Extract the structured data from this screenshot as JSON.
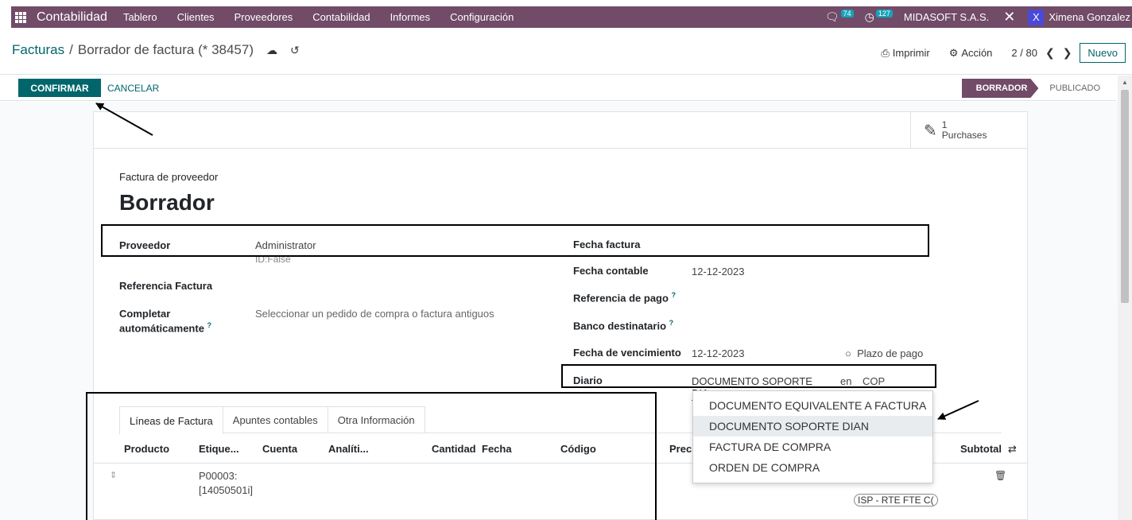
{
  "navbar": {
    "app_name": "Contabilidad",
    "menu": [
      "Tablero",
      "Clientes",
      "Proveedores",
      "Contabilidad",
      "Informes",
      "Configuración"
    ],
    "messages_count": "74",
    "activities_count": "127",
    "company": "MIDASOFT S.A.S.",
    "user_initial": "X",
    "user_name": "Ximena Gonzalez"
  },
  "control_panel": {
    "breadcrumb_parent": "Facturas",
    "breadcrumb_sep": "/",
    "breadcrumb_current": "Borrador de factura (* 38457)",
    "print_label": "Imprimir",
    "action_label": "Acción",
    "pager": "2 / 80",
    "new_label": "Nuevo"
  },
  "statusbar": {
    "confirm_label": "CONFIRMAR",
    "cancel_label": "CANCELAR",
    "stage_active": "BORRADOR",
    "stage_next": "PUBLICADO"
  },
  "smart_button": {
    "count": "1",
    "label": "Purchases"
  },
  "form": {
    "title_label": "Factura de proveedor",
    "title": "Borrador",
    "proveedor_label": "Proveedor",
    "proveedor_value": "Administrator",
    "proveedor_sub": "ID:False",
    "ref_label": "Referencia Factura",
    "autocomplete_label_1": "Completar",
    "autocomplete_label_2": "automáticamente",
    "autocomplete_placeholder": "Seleccionar un pedido de compra o factura antiguos",
    "fecha_factura_label": "Fecha factura",
    "fecha_contable_label": "Fecha contable",
    "fecha_contable_value": "12-12-2023",
    "ref_pago_label": "Referencia de pago",
    "banco_label": "Banco destinatario",
    "vencimiento_label": "Fecha de vencimiento",
    "vencimiento_value": "12-12-2023",
    "plazo_label": "Plazo de pago",
    "diario_label": "Diario",
    "diario_value": "DOCUMENTO SOPORTE DIA",
    "en_label": "en",
    "currency": "COP",
    "help_mark": "?"
  },
  "tabs": [
    "Líneas de Factura",
    "Apuntes contables",
    "Otra Información"
  ],
  "table": {
    "headers": [
      "Producto",
      "Etique...",
      "Cuenta",
      "Analíti...",
      "Cantidad",
      "Fecha",
      "Código",
      "Preci",
      "Subtotal"
    ],
    "row_label_1": "P00003:",
    "row_label_2": "[14050501i]",
    "tax_tag": "ISP - RTE FTE C("
  },
  "dropdown": {
    "options": [
      "DOCUMENTO EQUIVALENTE A FACTURA",
      "DOCUMENTO SOPORTE DIAN",
      "FACTURA DE COMPRA",
      "ORDEN DE COMPRA"
    ],
    "highlighted": "DOCUMENTO SOPORTE DIAN"
  }
}
